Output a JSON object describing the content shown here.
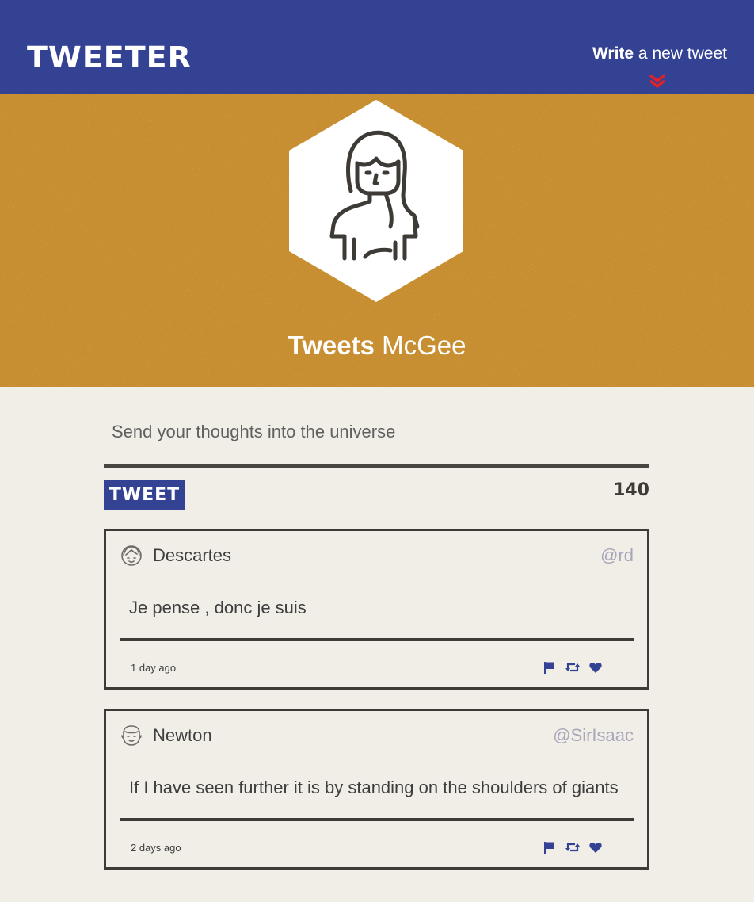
{
  "nav": {
    "logo": "TWEETER",
    "compose_bold": "Write",
    "compose_rest": " a new tweet"
  },
  "profile": {
    "name_bold": "Tweets",
    "name_rest": " McGee"
  },
  "composer": {
    "placeholder": "Send your thoughts into the universe",
    "button_label": "TWEET",
    "counter": "140"
  },
  "tweets": [
    {
      "name": "Descartes",
      "handle": "@rd",
      "text": "Je pense , donc je suis",
      "time": "1 day ago",
      "avatar_icon": "woman-face-icon"
    },
    {
      "name": "Newton",
      "handle": "@SirIsaac",
      "text": "If I have seen further it is by standing on the shoulders of giants",
      "time": "2 days ago",
      "avatar_icon": "man-face-icon"
    }
  ],
  "colors": {
    "nav_bg": "#334293",
    "header_bg": "#c78f31",
    "page_bg": "#f1eee8",
    "accent_red": "#e0202b",
    "action_icon": "#334293"
  }
}
